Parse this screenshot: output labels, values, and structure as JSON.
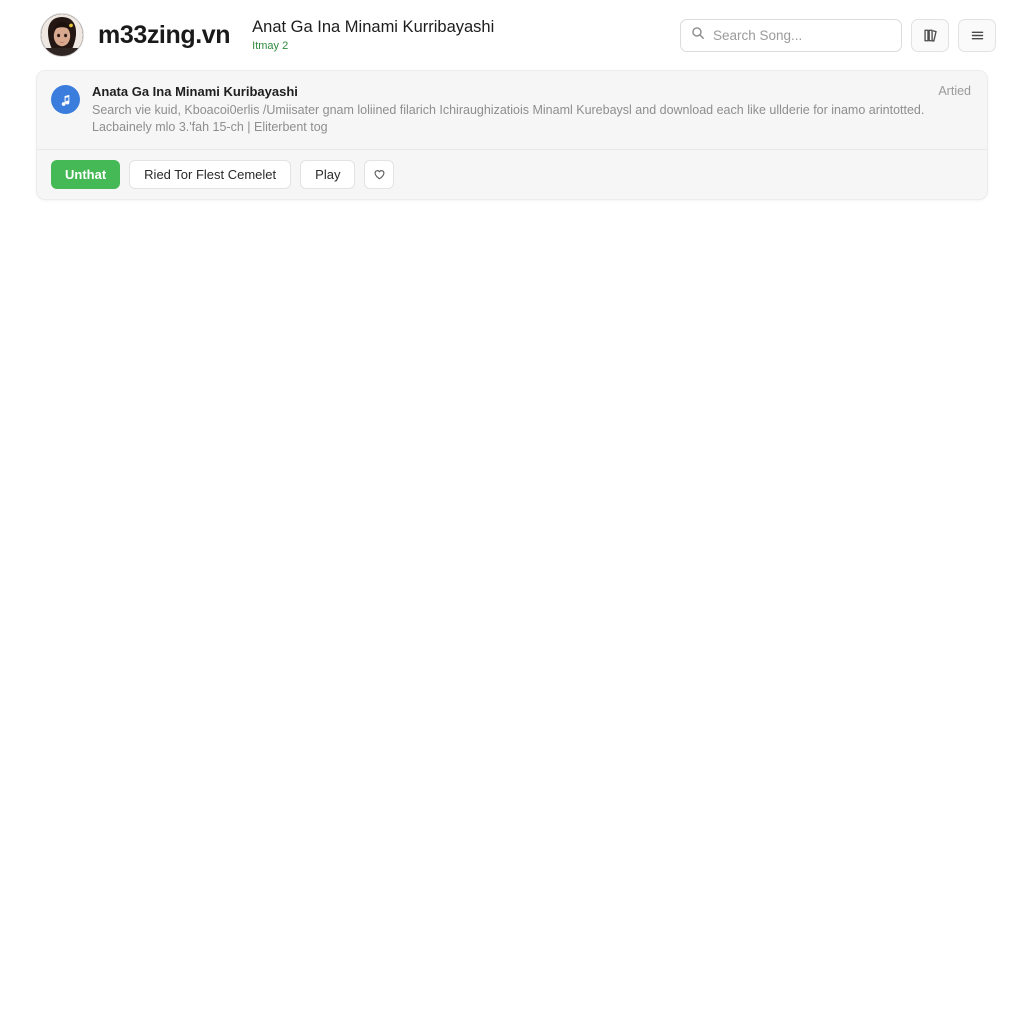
{
  "header": {
    "brand": "m33zing.vn",
    "avatar_icon": "user-avatar-photo",
    "title": "Anat Ga Ina Minami Kurribayashi",
    "subtitle": "Itmay 2",
    "subtitle_color": "#2e8b3d",
    "search": {
      "placeholder": "Search Song...",
      "value": "",
      "icon": "search-icon"
    },
    "library_button": {
      "icon": "library-book-icon",
      "label": ""
    },
    "menu_button": {
      "icon": "hamburger-menu-icon",
      "label": ""
    }
  },
  "card": {
    "badge_icon": "music-note-icon",
    "title": "Anata Ga Ina Minami Kuribayashi",
    "description_line1": "Search vie kuid, Kboacoi0erlis /Umiisater gnam loliined filarich Ichiraughizatiois Minaml Kurebaysl and download each like ullderie for inamo arintotted.",
    "description_line2": "Lacbainely mlo 3.'fah 15-ch | Eliterbent tog",
    "tag": "Artied",
    "actions": {
      "primary": {
        "label": "Unthat",
        "color": "#45b955"
      },
      "secondary": {
        "label": "Ried Tor Flest Cemelet"
      },
      "play": {
        "label": "Play"
      },
      "favorite": {
        "icon": "heart-icon",
        "label": ""
      }
    }
  }
}
